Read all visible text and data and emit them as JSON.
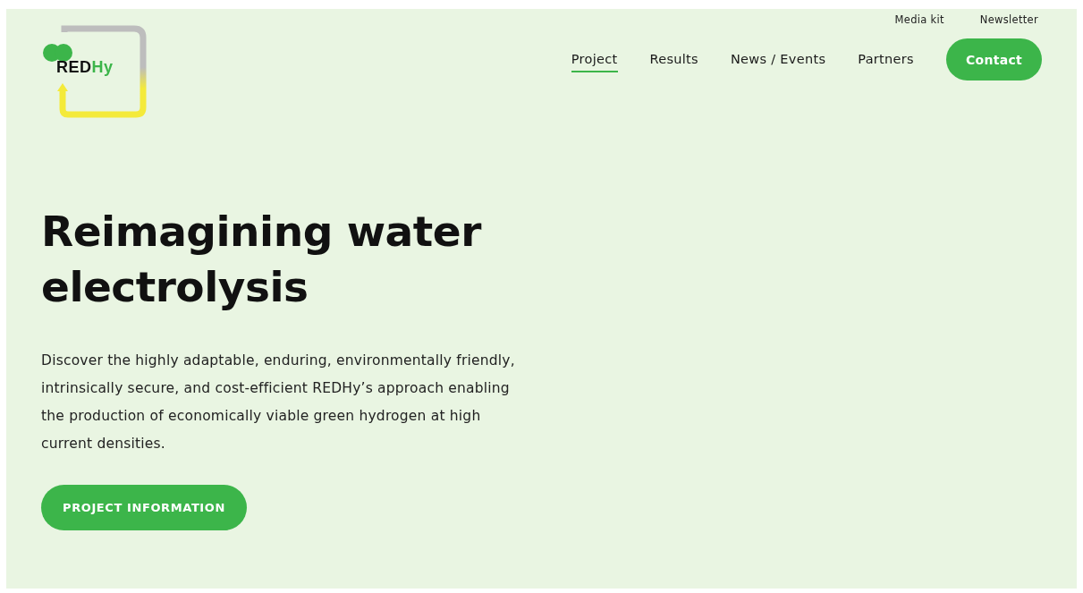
{
  "logo": {
    "prefix": "RED",
    "suffix": "Hy"
  },
  "top_links": [
    "Media kit",
    "Newsletter"
  ],
  "nav": [
    {
      "label": "Project",
      "selected": true
    },
    {
      "label": "Results",
      "selected": false
    },
    {
      "label": "News / Events",
      "selected": false
    },
    {
      "label": "Partners",
      "selected": false
    }
  ],
  "contact_button": "Contact",
  "hero": {
    "title": "Reimagining water electrolysis",
    "text": "Discover the highly adaptable, enduring, environmentally friendly, intrinsically secure, and cost-efficient REDHy’s approach enabling the production of economically viable green hydrogen at high current densities.",
    "button": "PROJECT INFORMATION"
  }
}
